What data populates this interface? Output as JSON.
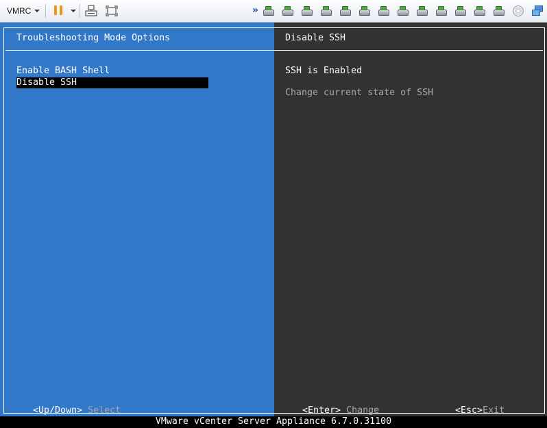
{
  "toolbar": {
    "vmrc_label": "VMRC",
    "icons": [
      "pause-icon",
      "send-ctrl-alt-del-icon",
      "fullscreen-icon",
      "more-devices-icon",
      "removable-device-icon",
      "cd-dvd-icon",
      "network-adapter-icon"
    ],
    "device_count": 13,
    "accent_pause": "#e8951c"
  },
  "left_panel": {
    "title": "Troubleshooting Mode Options",
    "menu_items": [
      "Enable BASH Shell",
      "Disable SSH"
    ],
    "selected_item": "Disable SSH",
    "background": "#3278c8"
  },
  "right_panel": {
    "title": "Disable SSH",
    "state": "SSH is Enabled",
    "description": "Change current state of SSH",
    "background": "#323232"
  },
  "hints": {
    "updown_key": "<Up/Down>",
    "updown_action": "Select",
    "enter_key": "<Enter>",
    "enter_action": "Change",
    "esc_key": "<Esc>",
    "esc_action": "Exit"
  },
  "status_bar": "VMware vCenter Server Appliance 6.7.0.31100"
}
